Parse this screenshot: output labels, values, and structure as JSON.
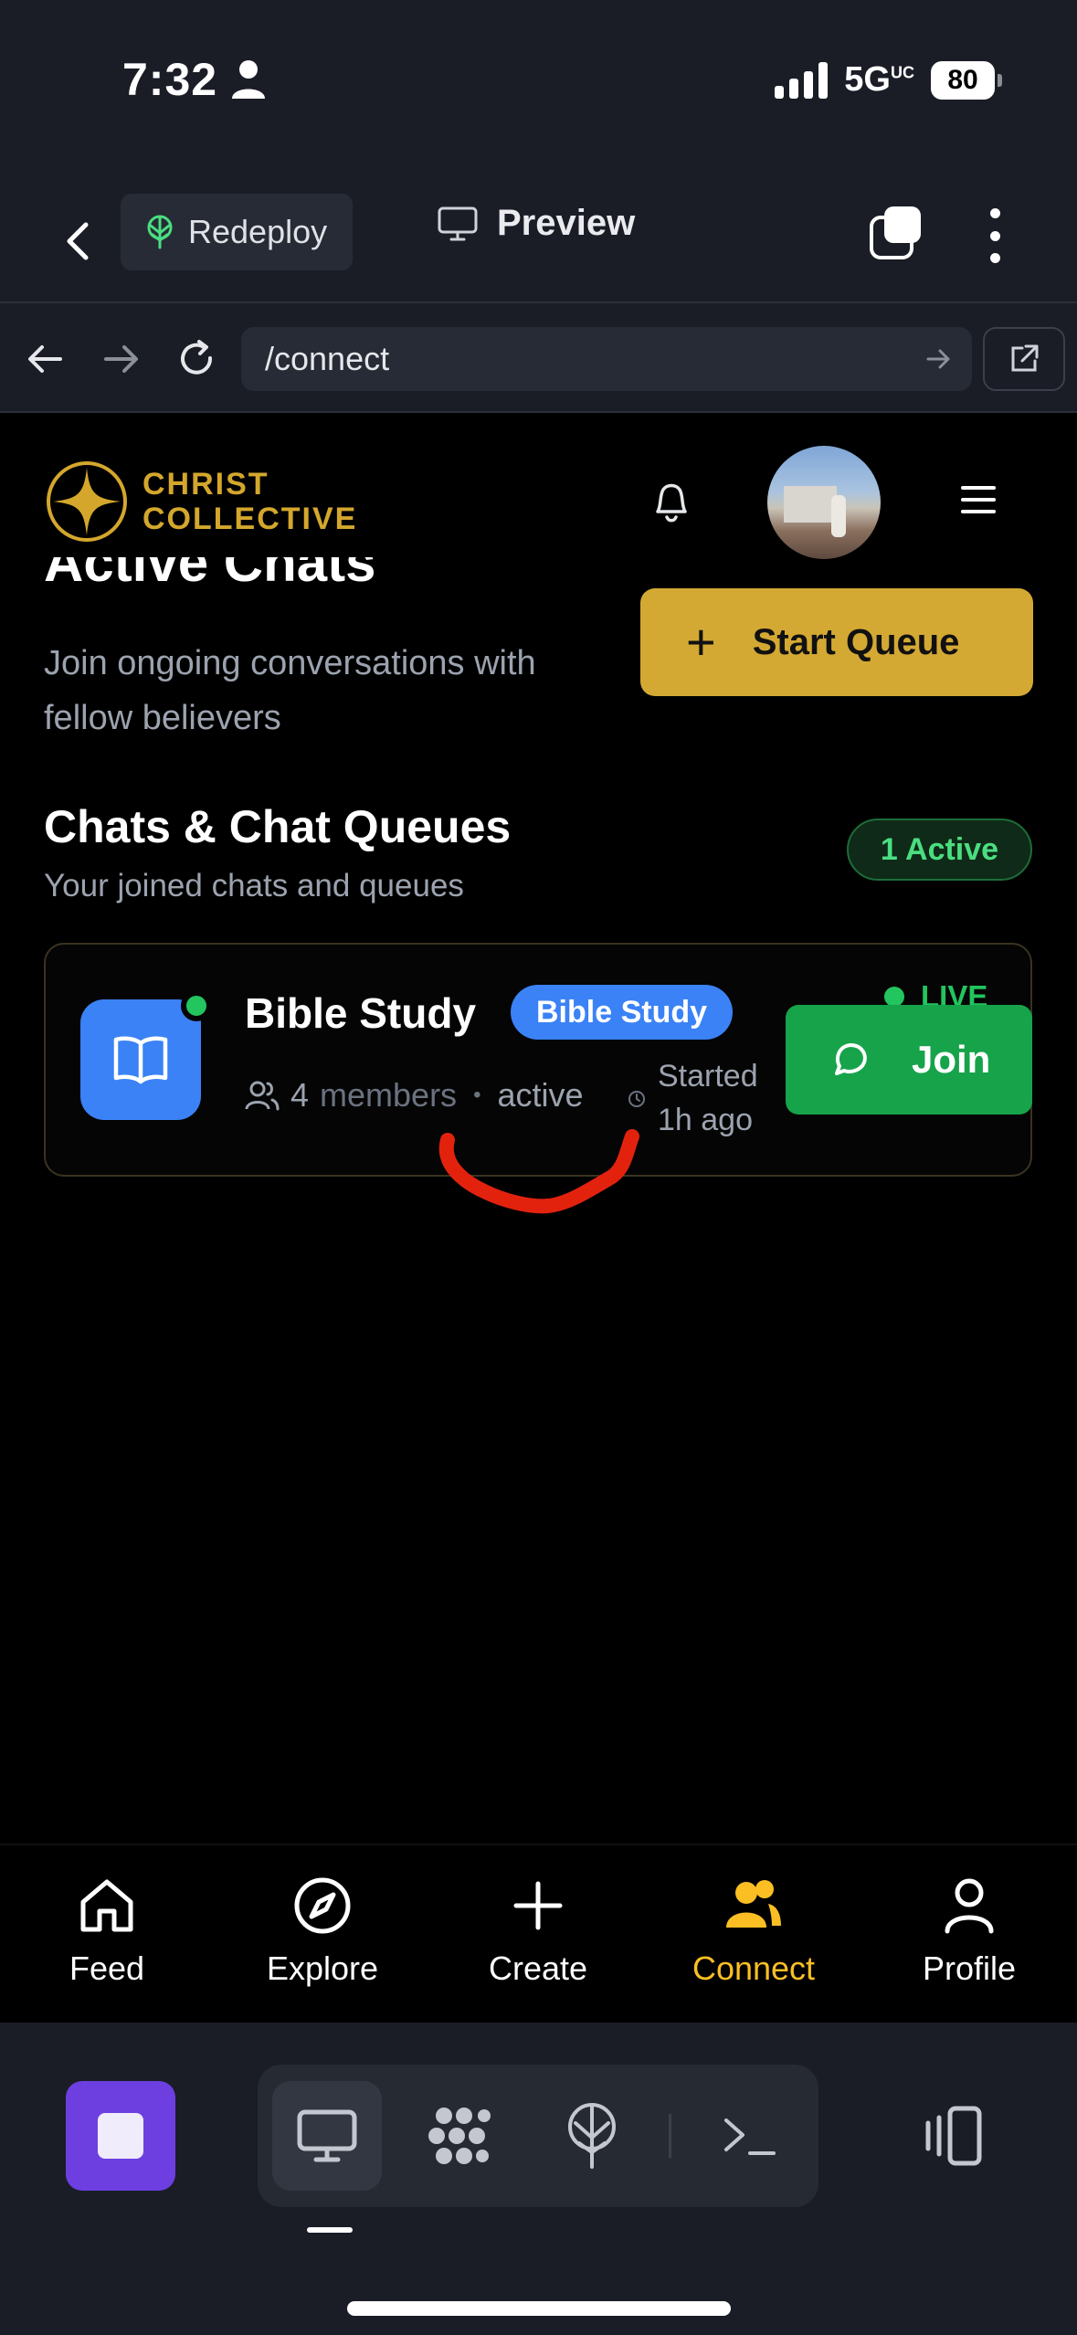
{
  "status_bar": {
    "time": "7:32",
    "network": "5G",
    "network_sup": "UC",
    "battery": "80"
  },
  "app_bar": {
    "redeploy_label": "Redeploy",
    "preview_label": "Preview"
  },
  "browser": {
    "url": "/connect"
  },
  "site_header": {
    "logo_line1": "CHRIST",
    "logo_line2": "COLLECTIVE"
  },
  "page": {
    "title": "Active Chats",
    "subtitle": "Join ongoing conversations with fellow believers",
    "start_queue_label": "Start Queue"
  },
  "section": {
    "title": "Chats & Chat Queues",
    "subtitle": "Your joined chats and queues",
    "active_count_label": "1 Active"
  },
  "chat": {
    "name": "Bible Study",
    "tag": "Bible Study",
    "member_count": "4",
    "members_label": "members",
    "separator": "•",
    "status": "active",
    "started": "Started 1h ago",
    "live_label": "LIVE",
    "join_label": "Join"
  },
  "tab_nav": [
    {
      "label": "Feed",
      "icon": "home-icon"
    },
    {
      "label": "Explore",
      "icon": "compass-icon"
    },
    {
      "label": "Create",
      "icon": "plus-icon"
    },
    {
      "label": "Connect",
      "icon": "users-icon",
      "active": true
    },
    {
      "label": "Profile",
      "icon": "user-icon"
    }
  ],
  "colors": {
    "accent_gold": "#d4a933",
    "active_tab": "#fbbf24",
    "join_green": "#16a34a",
    "tag_blue": "#3b82f6",
    "shell_navy": "#1a1d26"
  }
}
